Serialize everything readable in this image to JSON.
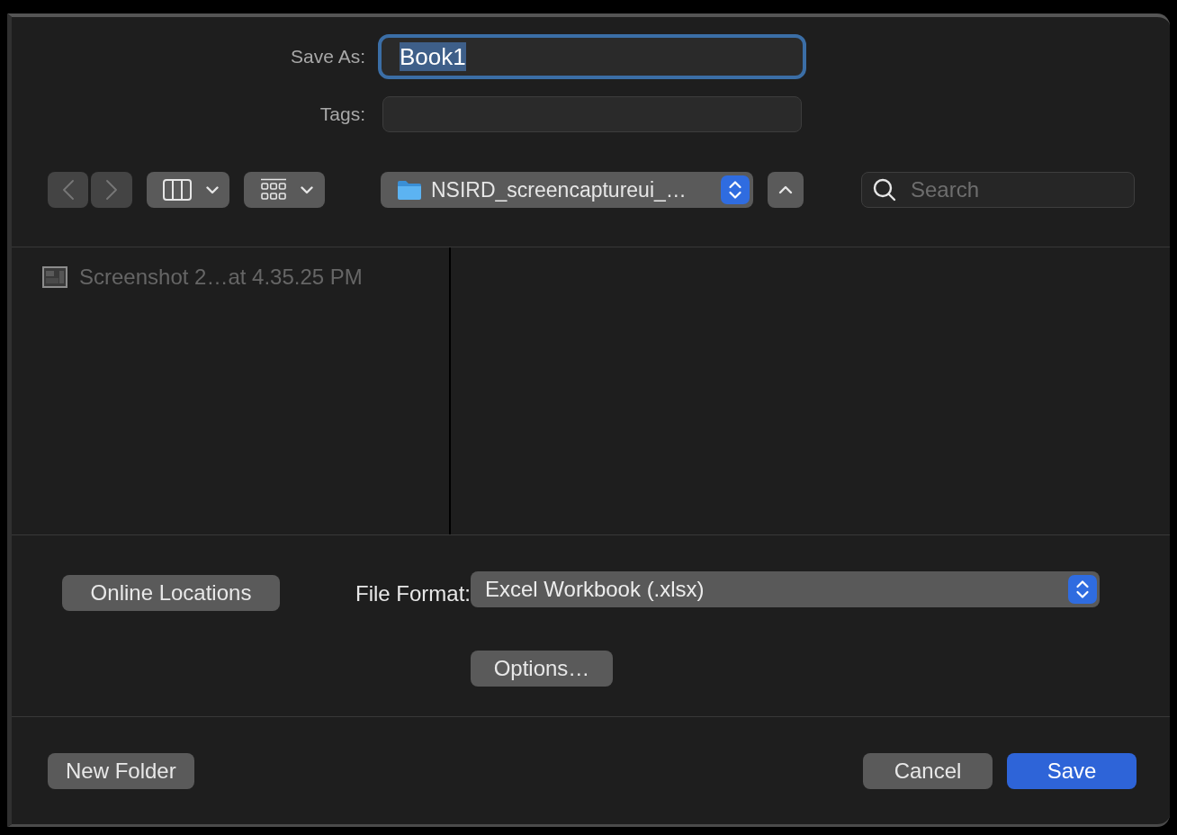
{
  "save_as": {
    "label": "Save As:",
    "value": "Book1",
    "focused": true
  },
  "tags": {
    "label": "Tags:"
  },
  "toolbar": {
    "items": [
      {
        "kind": "back",
        "disabled": true
      },
      {
        "kind": "forward",
        "disabled": true
      },
      {
        "kind": "columns_view",
        "disabled": false
      },
      {
        "kind": "icon_view",
        "disabled": false
      },
      {
        "kind": "location",
        "value": "NSIRD_screencaptureui_…"
      },
      {
        "kind": "up",
        "disabled": false
      },
      {
        "kind": "search",
        "placeholder": "Search"
      }
    ]
  },
  "browser": {
    "files": [
      {
        "name": "Screenshot 2…at 4.35.25 PM",
        "disabled": true
      }
    ]
  },
  "format_options": {
    "online_locations": "Online Locations",
    "file_format": {
      "label": "File Format:",
      "value": "Excel Workbook (.xlsx)"
    },
    "options": "Options…"
  },
  "footer": {
    "left_buttons": [
      {
        "label": "New Folder",
        "kind": "secondary"
      }
    ],
    "right_buttons": [
      {
        "label": "Cancel",
        "kind": "secondary"
      },
      {
        "label": "Save",
        "kind": "primary"
      }
    ]
  }
}
